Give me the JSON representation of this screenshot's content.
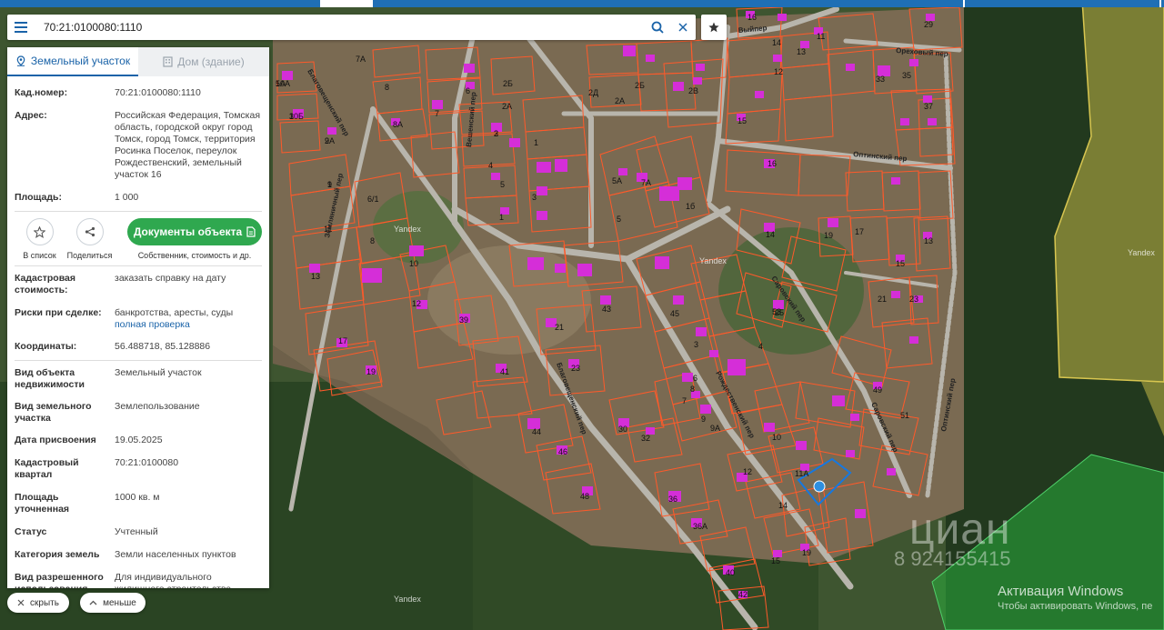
{
  "search": {
    "value": "70:21:0100080:1110"
  },
  "tabs": [
    {
      "label": "Земельный участок"
    },
    {
      "label": "Дом (здание)"
    }
  ],
  "info": {
    "cadnum": {
      "label": "Кад.номер:",
      "value": "70:21:0100080:1110"
    },
    "address": {
      "label": "Адрес:",
      "value": "Российская Федерация, Томская область, городской округ город Томск, город Томск, территория Росинка Поселок, переулок Рождественский, земельный участок 16"
    },
    "area": {
      "label": "Площадь:",
      "value": "1 000"
    }
  },
  "actions": {
    "list": "В список",
    "share": "Поделиться",
    "docs": "Документы объекта",
    "docs_sub": "Собственник, стоимость и др."
  },
  "details": {
    "cost": {
      "label": "Кадастровая стоимость:",
      "link": "заказать справку на дату"
    },
    "risks": {
      "label": "Риски при сделке:",
      "value": "банкротства, аресты, суды",
      "link": "полная проверка"
    },
    "coords": {
      "label": "Координаты:",
      "value": "56.488718, 85.128886"
    },
    "type": {
      "label": "Вид объекта недвижимости",
      "value": "Земельный участок"
    },
    "landtype": {
      "label": "Вид земельного участка",
      "value": "Землепользование"
    },
    "date": {
      "label": "Дата присвоения",
      "value": "19.05.2025"
    },
    "quarter": {
      "label": "Кадастровый квартал",
      "value": "70:21:0100080"
    },
    "area_exact": {
      "label": "Площадь уточненная",
      "value": "1000 кв. м"
    },
    "status": {
      "label": "Статус",
      "value": "Учтенный"
    },
    "category": {
      "label": "Категория земель",
      "value": "Земли населенных пунктов"
    },
    "usage": {
      "label": "Вид разрешенного использования",
      "value": "Для индивидуального жилищного строительства"
    }
  },
  "bottom": {
    "hide": "скрыть",
    "less": "меньше"
  },
  "map": {
    "streets": [
      {
        "name": "Благовещенский пер"
      },
      {
        "name": "Благовещенский пер"
      },
      {
        "name": "Рождественский пер"
      },
      {
        "name": "Саровский пер"
      },
      {
        "name": "Саровский пер"
      },
      {
        "name": "Оптинский пер"
      },
      {
        "name": "Оптинский пер"
      },
      {
        "name": "Ореховый пер"
      },
      {
        "name": "Выйпер"
      },
      {
        "name": "Земляничный пер"
      },
      {
        "name": "Вешенский пер"
      }
    ],
    "labels": [
      "10А",
      "10Б",
      "9А",
      "9",
      "11",
      "13",
      "17",
      "19",
      "8А",
      "8",
      "7А",
      "7",
      "6",
      "5",
      "4",
      "3",
      "2Б",
      "2А",
      "2",
      "1",
      "2Д",
      "2Б",
      "2В",
      "2А",
      "16",
      "14",
      "12",
      "15",
      "13",
      "11",
      "33",
      "35",
      "37",
      "29",
      "19",
      "17",
      "15",
      "13",
      "21",
      "23",
      "25",
      "5А",
      "7А",
      "1б",
      "5",
      "3",
      "1",
      "6/1",
      "8",
      "10",
      "12",
      "39",
      "41",
      "43",
      "45",
      "3",
      "4",
      "6",
      "7",
      "8",
      "9",
      "9А",
      "10",
      "11А",
      "12",
      "14",
      "15",
      "19",
      "21",
      "23",
      "30",
      "32",
      "36",
      "36А",
      "40",
      "42",
      "44",
      "46",
      "48",
      "49",
      "51",
      "53",
      "16",
      "14",
      "5А",
      "3",
      "2",
      "1"
    ],
    "yandex": "Yandex"
  },
  "watermark": {
    "cian": "циан",
    "phone": "8 924155415",
    "win_title": "Активация Windows",
    "win_sub": "Чтобы активировать Windows, пе"
  },
  "colors": {
    "accent": "#1a63a8",
    "docs_button": "#2fa84f",
    "parcel": "#ff5a2a",
    "building": "#d52ed8"
  }
}
